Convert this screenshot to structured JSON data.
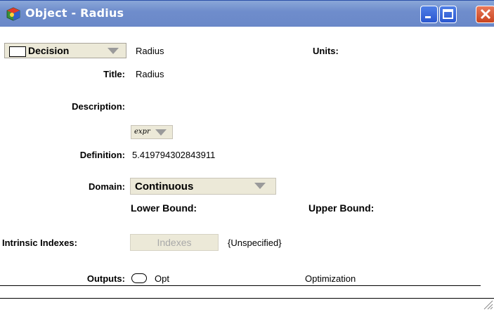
{
  "window": {
    "title": "Object - Radius",
    "controls": {
      "minimize": "minimize",
      "maximize": "maximize",
      "close": "close"
    },
    "colors": {
      "titlebar": "#6f8dcc",
      "close": "#c9441f"
    }
  },
  "object": {
    "class_value": "Decision",
    "identifier": "Radius",
    "units_label": "Units:",
    "title_label": "Title:",
    "title_value": "Radius",
    "description_label": "Description:",
    "expr_selector": "expr",
    "definition_label": "Definition:",
    "definition_value": "5.419794302843911",
    "domain_label": "Domain:",
    "domain_value": "Continuous",
    "lower_bound_label": "Lower Bound:",
    "upper_bound_label": "Upper Bound:",
    "intrinsic_indexes_label": "Intrinsic Indexes:",
    "indexes_button": "Indexes",
    "indexes_value": "{Unspecified}",
    "outputs_label": "Outputs:",
    "output_name": "Opt",
    "output_title": "Optimization"
  }
}
